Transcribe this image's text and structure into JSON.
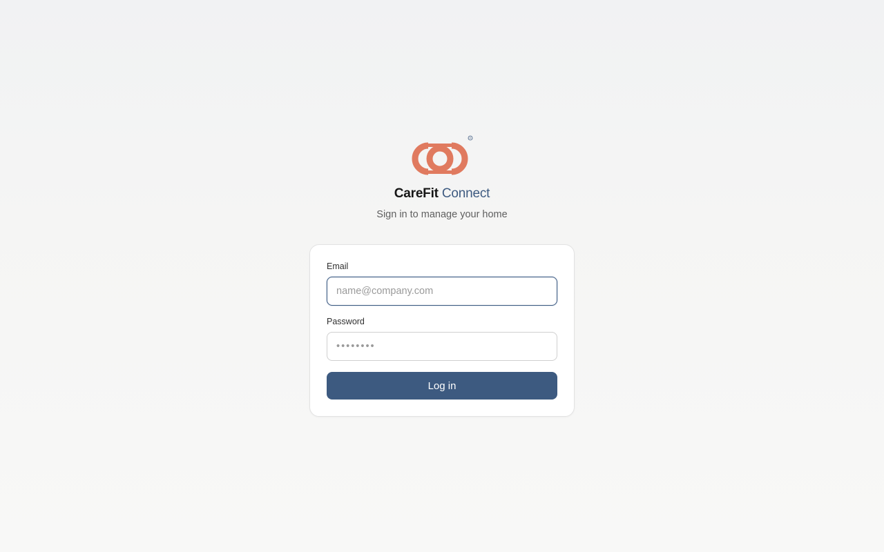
{
  "brand": {
    "name_part1": "CareFit",
    "name_part2": "Connect",
    "logo_icon": "carefit-logo-icon",
    "registered_mark": "®",
    "accent_color": "#3d5a80",
    "logo_color": "#e07a5f"
  },
  "subtitle": "Sign in to manage your home",
  "form": {
    "email_label": "Email",
    "email_placeholder": "name@company.com",
    "email_value": "",
    "password_label": "Password",
    "password_placeholder": "••••••••",
    "password_value": "",
    "submit_label": "Log in"
  }
}
